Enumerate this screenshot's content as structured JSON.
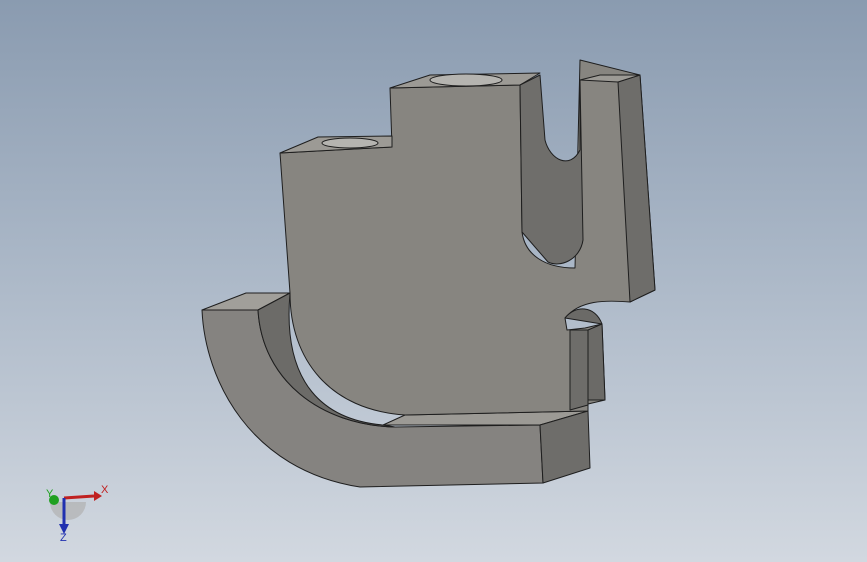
{
  "viewport": {
    "background_top": "#8a9bb0",
    "background_bottom": "#d2d8e0",
    "part_face_color": "#868480",
    "part_side_color": "#6f6e6b",
    "part_top_color": "#9a9893",
    "edge_color": "#1e1e1e"
  },
  "triad": {
    "x_label": "X",
    "y_label": "Y",
    "z_label": "Z",
    "x_color": "#c02020",
    "y_color": "#20a020",
    "z_color": "#2030b0"
  }
}
